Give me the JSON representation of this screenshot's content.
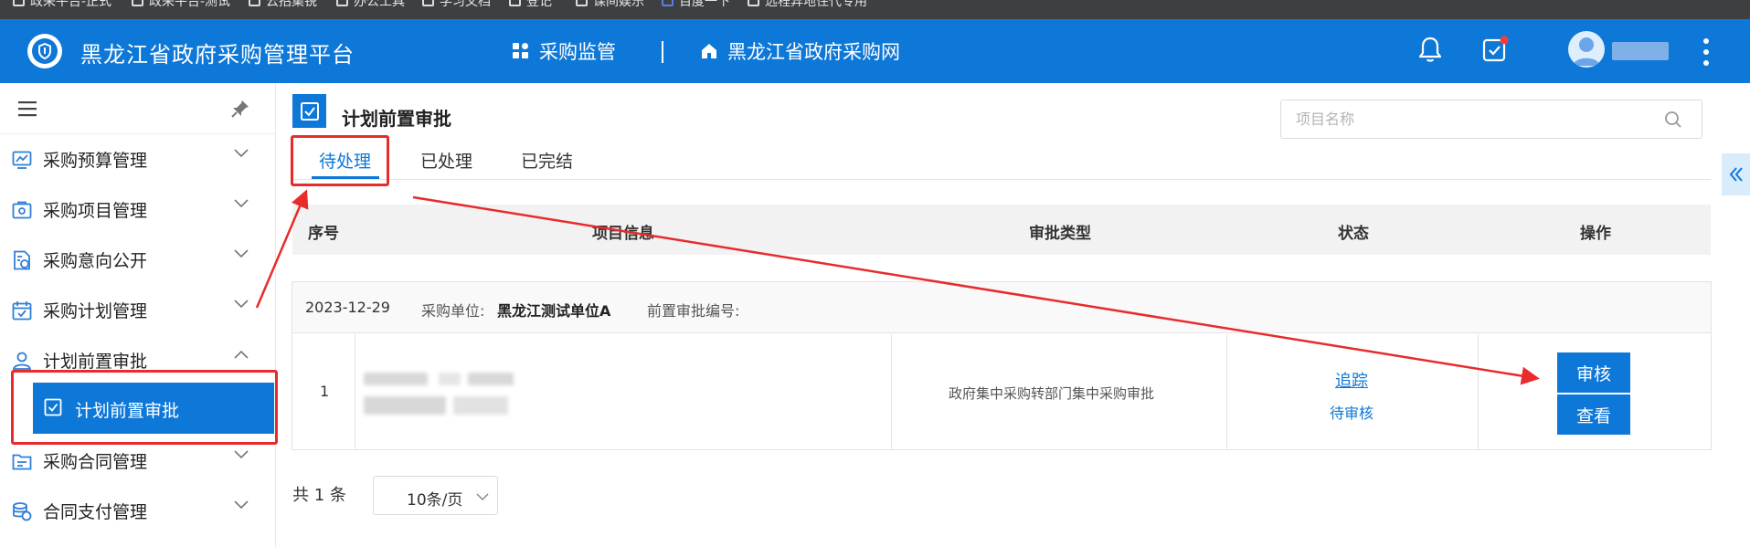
{
  "bookmarks": [
    {
      "label": "政采平台-正式"
    },
    {
      "label": "政采平台-测试"
    },
    {
      "label": "云招集锐"
    },
    {
      "label": "办公工具"
    },
    {
      "label": "学习文档"
    },
    {
      "label": "登记"
    },
    {
      "label": "课间娱乐"
    },
    {
      "label": "百度一下"
    },
    {
      "label": "远程异地住代专用"
    }
  ],
  "header": {
    "app_title": "黑龙江省政府采购管理平台",
    "nav": [
      {
        "label": "采购监管",
        "icon": "grid-icon"
      },
      {
        "label": "黑龙江省政府采购网",
        "icon": "home-icon"
      }
    ],
    "icons": [
      "bell-icon",
      "task-check-icon",
      "more-vertical-icon"
    ],
    "notification_dot_color": "#ff3b30"
  },
  "sidebar": {
    "items": [
      {
        "label": "采购预算管理",
        "icon": "chart-icon",
        "expanded": false
      },
      {
        "label": "采购项目管理",
        "icon": "project-icon",
        "expanded": false
      },
      {
        "label": "采购意向公开",
        "icon": "document-icon",
        "expanded": false
      },
      {
        "label": "采购计划管理",
        "icon": "calendar-icon",
        "expanded": false
      },
      {
        "label": "计划前置审批",
        "icon": "user-icon",
        "expanded": true
      },
      {
        "label": "采购合同管理",
        "icon": "folder-icon",
        "expanded": false
      },
      {
        "label": "合同支付管理",
        "icon": "coins-icon",
        "expanded": false
      }
    ],
    "active_sub_item": {
      "label": "计划前置审批",
      "icon": "approve-icon"
    }
  },
  "page": {
    "title": "计划前置审批",
    "search_placeholder": "项目名称",
    "tabs": [
      {
        "label": "待处理",
        "active": true
      },
      {
        "label": "已处理",
        "active": false
      },
      {
        "label": "已完结",
        "active": false
      }
    ]
  },
  "table": {
    "columns": [
      "序号",
      "项目信息",
      "审批类型",
      "状态",
      "操作"
    ],
    "groups": [
      {
        "date": "2023-12-29",
        "unit_label": "采购单位:",
        "unit_value": "黑龙江测试单位A",
        "approval_no_label": "前置审批编号:",
        "rows": [
          {
            "index": "1",
            "approval_type": "政府集中采购转部门集中采购审批",
            "status_link": "追踪",
            "status": "待审核",
            "actions": [
              "审核",
              "查看"
            ]
          }
        ]
      }
    ]
  },
  "pagination": {
    "total": "共 1 条",
    "page_size": "10条/页"
  },
  "colors": {
    "primary": "#0e78d8",
    "annotation": "#e82b2b"
  }
}
